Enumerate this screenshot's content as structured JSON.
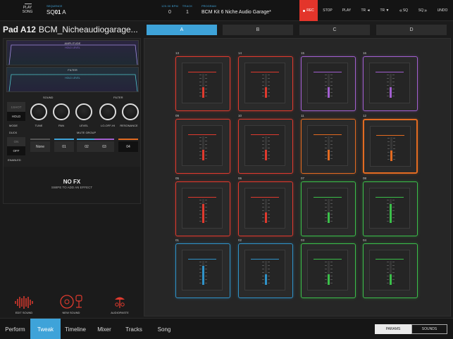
{
  "topbar": {
    "play_song": "PLAY\nSONG",
    "sequence_label": "SEQUENCE",
    "sequence_prefix": "SQ",
    "sequence_number": "01",
    "sequence_name": "A",
    "bpm_label": "120.00 BPM",
    "bpm_value": "0",
    "track_label": "TRACK",
    "track_value": "1",
    "program_label": "PROGRAM",
    "program_value": "BCM Kit 6 Niche Audio Garage*",
    "rec": "REC",
    "stop": "STOP",
    "play": "PLAY",
    "tr_left": "TR ◄",
    "tr_right": "TR ▼",
    "sq_prev": "SQ",
    "sq_next": "SQ",
    "undo": "UNDO"
  },
  "header": {
    "pad_label": "Pad A12",
    "pad_name": "BCM_Nicheaudiogarage..."
  },
  "banks": [
    "A",
    "B",
    "C",
    "D"
  ],
  "active_bank": "A",
  "envelopes": {
    "amplitude": "AMPLITUDE",
    "filter": "FILTER",
    "hold_level": "HOLD LEVEL"
  },
  "controls": {
    "sound_label": "SOUND",
    "filter_label": "FILTER",
    "oneshot": "1SHOT",
    "hold": "HOLD",
    "mode": "MODE",
    "duck": "DUCK",
    "on": "ON",
    "off": "OFF",
    "enabled": "ENABLED",
    "knobs": [
      "TUNE",
      "PAN",
      "LEVEL",
      "LO-OFF-HI",
      "RESONANCE"
    ],
    "mute_group": "MUTE GROUP",
    "mute_buttons": [
      "None",
      "01",
      "02",
      "03",
      "04"
    ],
    "mute_colors": [
      "#555555",
      "#3ea3d9",
      "#3ea3d9",
      "#a25fd0",
      "#e36b21"
    ],
    "mute_active": "04"
  },
  "fx": {
    "title": "NO FX",
    "subtitle": "SWIPE TO ADD AN EFFECT"
  },
  "tools": [
    {
      "label": "EDIT SOUND",
      "icon": "waveform-icon"
    },
    {
      "label": "NEW SOUND",
      "icon": "turntable-icon"
    },
    {
      "label": "AUDIOPASTE",
      "icon": "audiopaste-icon"
    }
  ],
  "pads": [
    {
      "num": "13",
      "color": "#e03a2e",
      "level": 0.45
    },
    {
      "num": "14",
      "color": "#e03a2e",
      "level": 0.45
    },
    {
      "num": "15",
      "color": "#a25fd0",
      "level": 0.45
    },
    {
      "num": "16",
      "color": "#a25fd0",
      "level": 0.45
    },
    {
      "num": "09",
      "color": "#e03a2e",
      "level": 0.45
    },
    {
      "num": "10",
      "color": "#e03a2e",
      "level": 0.45
    },
    {
      "num": "11",
      "color": "#e36b21",
      "level": 0.45
    },
    {
      "num": "12",
      "color": "#e36b21",
      "level": 0.45,
      "selected": true
    },
    {
      "num": "05",
      "color": "#e03a2e",
      "level": 0.8
    },
    {
      "num": "06",
      "color": "#e03a2e",
      "level": 0.45
    },
    {
      "num": "07",
      "color": "#3bbf4a",
      "level": 0.45
    },
    {
      "num": "08",
      "color": "#3bbf4a",
      "level": 0.8
    },
    {
      "num": "01",
      "color": "#2f93c9",
      "level": 0.8
    },
    {
      "num": "02",
      "color": "#2f93c9",
      "level": 0.45
    },
    {
      "num": "03",
      "color": "#3bbf4a",
      "level": 0.45
    },
    {
      "num": "04",
      "color": "#3bbf4a",
      "level": 0.45
    }
  ],
  "nav": {
    "tabs": [
      "Perform",
      "Tweak",
      "Timeline",
      "Mixer",
      "Tracks",
      "Song"
    ],
    "active_tab": "Tweak",
    "params": "PARAMS",
    "sounds": "SOUNDS"
  }
}
